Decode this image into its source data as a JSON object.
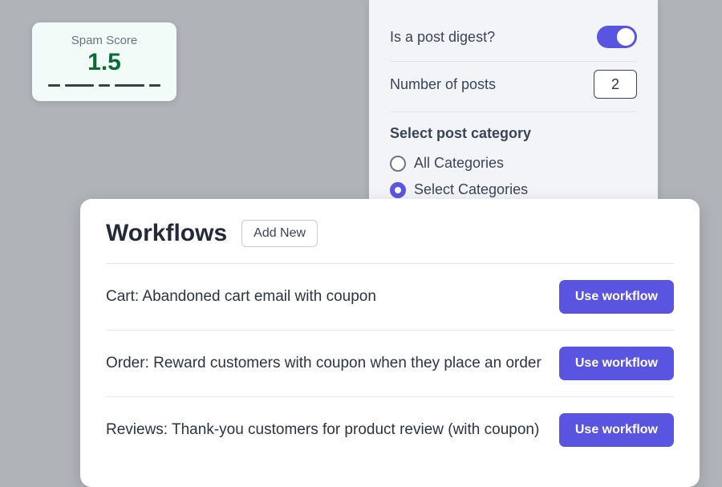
{
  "spam": {
    "title": "Spam Score",
    "value": "1.5"
  },
  "settings": {
    "digest_label": "Is a post digest?",
    "digest_on": true,
    "num_posts_label": "Number of posts",
    "num_posts_value": "2",
    "category_heading": "Select post category",
    "radio_all": "All Categories",
    "radio_select": "Select Categories",
    "radio_selected": "select"
  },
  "workflows": {
    "title": "Workflows",
    "add_new_label": "Add New",
    "use_label": "Use workflow",
    "items": [
      {
        "name": "Cart: Abandoned cart email with coupon"
      },
      {
        "name": "Order: Reward customers with coupon when they place an order"
      },
      {
        "name": "Reviews: Thank-you customers for product review (with coupon)"
      }
    ]
  }
}
